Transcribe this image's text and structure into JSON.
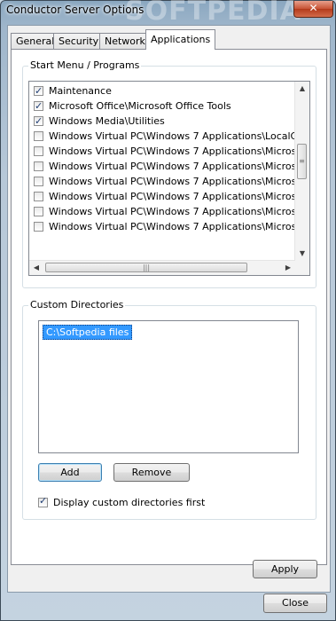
{
  "window": {
    "title": "Conductor Server Options",
    "watermark": "SOFTPEDIA",
    "close_glyph": "✕"
  },
  "tabs": [
    {
      "label": "General",
      "active": false
    },
    {
      "label": "Security",
      "active": false
    },
    {
      "label": "Network",
      "active": false
    },
    {
      "label": "Applications",
      "active": true
    }
  ],
  "start_menu": {
    "group_label": "Start Menu / Programs",
    "items": [
      {
        "label": "Maintenance",
        "checked": true
      },
      {
        "label": "Microsoft Office\\Microsoft Office Tools",
        "checked": true
      },
      {
        "label": "Windows Media\\Utilities",
        "checked": true
      },
      {
        "label": "Windows Virtual PC\\Windows 7 Applications\\LocalGPO",
        "checked": false
      },
      {
        "label": "Windows Virtual PC\\Windows 7 Applications\\Microsoft",
        "checked": false
      },
      {
        "label": "Windows Virtual PC\\Windows 7 Applications\\Microsoft",
        "checked": false
      },
      {
        "label": "Windows Virtual PC\\Windows 7 Applications\\Microsoft",
        "checked": false
      },
      {
        "label": "Windows Virtual PC\\Windows 7 Applications\\Microsoft",
        "checked": false
      },
      {
        "label": "Windows Virtual PC\\Windows 7 Applications\\Microsoft",
        "checked": false
      },
      {
        "label": "Windows Virtual PC\\Windows 7 Applications\\Microsoft",
        "checked": false
      }
    ]
  },
  "custom_dirs": {
    "group_label": "Custom Directories",
    "items": [
      "C:\\Softpedia files"
    ],
    "add_label": "Add",
    "remove_label": "Remove",
    "display_first_label": "Display custom directories first",
    "display_first_checked": true
  },
  "buttons": {
    "apply_label": "Apply",
    "close_label": "Close"
  },
  "scroll_glyphs": {
    "up": "▲",
    "down": "▼",
    "left": "◀",
    "right": "▶",
    "grip_v": "≡",
    "grip_h": "|||"
  }
}
